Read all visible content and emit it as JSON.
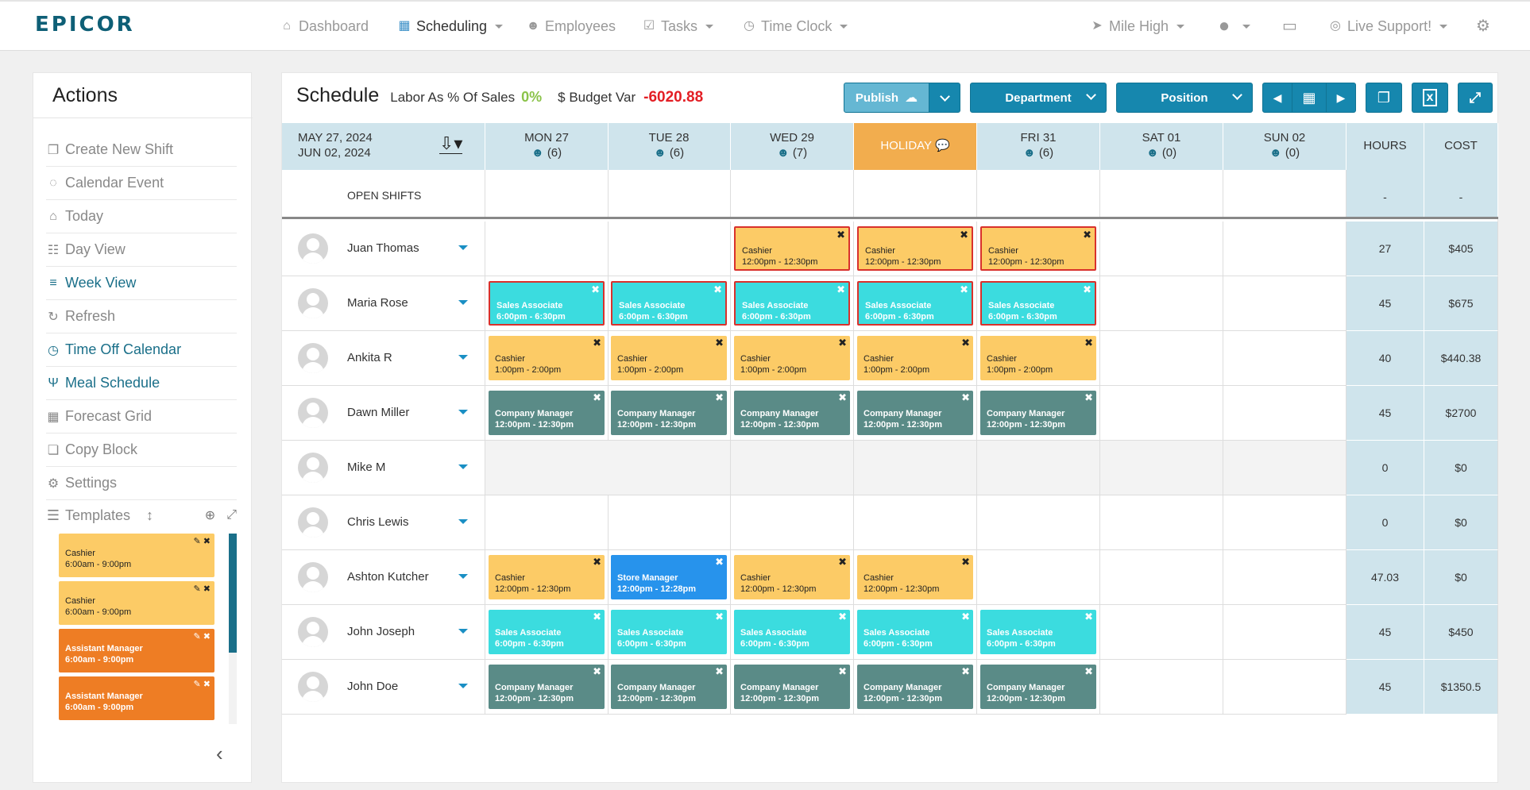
{
  "brand": "EPICOR",
  "nav": {
    "dashboard": "Dashboard",
    "scheduling": "Scheduling",
    "employees": "Employees",
    "tasks": "Tasks",
    "time_clock": "Time Clock",
    "location": "Mile High",
    "support": "Live Support!"
  },
  "sidebar": {
    "title": "Actions",
    "items": [
      {
        "label": "Create New Shift",
        "icon": "copy-icon",
        "style": "grey"
      },
      {
        "label": "Calendar Event",
        "icon": "comment-icon",
        "style": "grey"
      },
      {
        "label": "Today",
        "icon": "home-icon",
        "style": "grey"
      },
      {
        "label": "Day View",
        "icon": "list-icon",
        "style": "grey"
      },
      {
        "label": "Week View",
        "icon": "bars-icon",
        "style": "blue"
      },
      {
        "label": "Refresh",
        "icon": "refresh-icon",
        "style": "grey"
      },
      {
        "label": "Time Off Calendar",
        "icon": "clock-icon",
        "style": "blue"
      },
      {
        "label": "Meal Schedule",
        "icon": "utensils-icon",
        "style": "blue"
      },
      {
        "label": "Forecast Grid",
        "icon": "grid-icon",
        "style": "grey"
      },
      {
        "label": "Copy Block",
        "icon": "clone-icon",
        "style": "grey"
      },
      {
        "label": "Settings",
        "icon": "cogs-icon",
        "style": "grey"
      }
    ],
    "templates_label": "Templates",
    "templates": [
      {
        "role": "Cashier",
        "time": "6:00am - 9:00pm",
        "color": "yellow"
      },
      {
        "role": "Cashier",
        "time": "6:00am - 9:00pm",
        "color": "yellow"
      },
      {
        "role": "Assistant Manager",
        "time": "6:00am - 9:00pm",
        "color": "orange"
      },
      {
        "role": "Assistant Manager",
        "time": "6:00am - 9:00pm",
        "color": "orange"
      },
      {
        "role": "",
        "time": "",
        "color": "teal"
      }
    ]
  },
  "schedule": {
    "title": "Schedule",
    "labor_label": "Labor As % Of Sales",
    "labor_value": "0%",
    "budget_label": "$ Budget Var",
    "budget_value": "-6020.88",
    "publish": "Publish",
    "department": "Department",
    "position": "Position",
    "range_start": "MAY 27, 2024",
    "range_end": "JUN 02, 2024",
    "days": [
      {
        "label": "MON 27",
        "count": "(6)",
        "holiday": false
      },
      {
        "label": "TUE 28",
        "count": "(6)",
        "holiday": false
      },
      {
        "label": "WED 29",
        "count": "(7)",
        "holiday": false
      },
      {
        "label": "HOLIDAY",
        "count": "",
        "holiday": true
      },
      {
        "label": "FRI 31",
        "count": "(6)",
        "holiday": false
      },
      {
        "label": "SAT 01",
        "count": "(0)",
        "holiday": false
      },
      {
        "label": "SUN 02",
        "count": "(0)",
        "holiday": false
      }
    ],
    "hours_header": "HOURS",
    "cost_header": "COST",
    "open_shifts": {
      "label": "OPEN SHIFTS",
      "hours": "-",
      "cost": "-"
    },
    "employees": [
      {
        "name": "Juan Thomas",
        "hours": "27",
        "cost": "$405",
        "grey": false,
        "shifts": [
          {
            "day": 2,
            "role": "Cashier",
            "time": "12:00pm - 12:30pm",
            "color": "yellow",
            "alert": true
          },
          {
            "day": 3,
            "role": "Cashier",
            "time": "12:00pm - 12:30pm",
            "color": "yellow",
            "alert": true
          },
          {
            "day": 4,
            "role": "Cashier",
            "time": "12:00pm - 12:30pm",
            "color": "yellow",
            "alert": true
          }
        ]
      },
      {
        "name": "Maria Rose",
        "hours": "45",
        "cost": "$675",
        "grey": false,
        "shifts": [
          {
            "day": 0,
            "role": "Sales Associate",
            "time": "6:00pm - 6:30pm",
            "color": "teal",
            "alert": true
          },
          {
            "day": 1,
            "role": "Sales Associate",
            "time": "6:00pm - 6:30pm",
            "color": "teal",
            "alert": true
          },
          {
            "day": 2,
            "role": "Sales Associate",
            "time": "6:00pm - 6:30pm",
            "color": "teal",
            "alert": true
          },
          {
            "day": 3,
            "role": "Sales Associate",
            "time": "6:00pm - 6:30pm",
            "color": "teal",
            "alert": true
          },
          {
            "day": 4,
            "role": "Sales Associate",
            "time": "6:00pm - 6:30pm",
            "color": "teal",
            "alert": true
          }
        ]
      },
      {
        "name": "Ankita R",
        "hours": "40",
        "cost": "$440.38",
        "grey": false,
        "shifts": [
          {
            "day": 0,
            "role": "Cashier",
            "time": "1:00pm - 2:00pm",
            "color": "yellow",
            "alert": false
          },
          {
            "day": 1,
            "role": "Cashier",
            "time": "1:00pm - 2:00pm",
            "color": "yellow",
            "alert": false
          },
          {
            "day": 2,
            "role": "Cashier",
            "time": "1:00pm - 2:00pm",
            "color": "yellow",
            "alert": false
          },
          {
            "day": 3,
            "role": "Cashier",
            "time": "1:00pm - 2:00pm",
            "color": "yellow",
            "alert": false
          },
          {
            "day": 4,
            "role": "Cashier",
            "time": "1:00pm - 2:00pm",
            "color": "yellow",
            "alert": false
          }
        ]
      },
      {
        "name": "Dawn Miller",
        "hours": "45",
        "cost": "$2700",
        "grey": false,
        "shifts": [
          {
            "day": 0,
            "role": "Company Manager",
            "time": "12:00pm - 12:30pm",
            "color": "dark",
            "alert": false
          },
          {
            "day": 1,
            "role": "Company Manager",
            "time": "12:00pm - 12:30pm",
            "color": "dark",
            "alert": false
          },
          {
            "day": 2,
            "role": "Company Manager",
            "time": "12:00pm - 12:30pm",
            "color": "dark",
            "alert": false
          },
          {
            "day": 3,
            "role": "Company Manager",
            "time": "12:00pm - 12:30pm",
            "color": "dark",
            "alert": false
          },
          {
            "day": 4,
            "role": "Company Manager",
            "time": "12:00pm - 12:30pm",
            "color": "dark",
            "alert": false
          }
        ]
      },
      {
        "name": "Mike M",
        "hours": "0",
        "cost": "$0",
        "grey": true,
        "shifts": []
      },
      {
        "name": "Chris Lewis",
        "hours": "0",
        "cost": "$0",
        "grey": false,
        "shifts": []
      },
      {
        "name": "Ashton Kutcher",
        "hours": "47.03",
        "cost": "$0",
        "grey": false,
        "shifts": [
          {
            "day": 0,
            "role": "Cashier",
            "time": "12:00pm - 12:30pm",
            "color": "yellow",
            "alert": false
          },
          {
            "day": 1,
            "role": "Store Manager",
            "time": "12:00pm - 12:28pm",
            "color": "blue",
            "alert": false
          },
          {
            "day": 2,
            "role": "Cashier",
            "time": "12:00pm - 12:30pm",
            "color": "yellow",
            "alert": false
          },
          {
            "day": 3,
            "role": "Cashier",
            "time": "12:00pm - 12:30pm",
            "color": "yellow",
            "alert": false
          }
        ]
      },
      {
        "name": "John Joseph",
        "hours": "45",
        "cost": "$450",
        "grey": false,
        "shifts": [
          {
            "day": 0,
            "role": "Sales Associate",
            "time": "6:00pm - 6:30pm",
            "color": "teal",
            "alert": false
          },
          {
            "day": 1,
            "role": "Sales Associate",
            "time": "6:00pm - 6:30pm",
            "color": "teal",
            "alert": false
          },
          {
            "day": 2,
            "role": "Sales Associate",
            "time": "6:00pm - 6:30pm",
            "color": "teal",
            "alert": false
          },
          {
            "day": 3,
            "role": "Sales Associate",
            "time": "6:00pm - 6:30pm",
            "color": "teal",
            "alert": false
          },
          {
            "day": 4,
            "role": "Sales Associate",
            "time": "6:00pm - 6:30pm",
            "color": "teal",
            "alert": false
          }
        ]
      },
      {
        "name": "John Doe",
        "hours": "45",
        "cost": "$1350.5",
        "grey": false,
        "shifts": [
          {
            "day": 0,
            "role": "Company Manager",
            "time": "12:00pm - 12:30pm",
            "color": "dark",
            "alert": false
          },
          {
            "day": 1,
            "role": "Company Manager",
            "time": "12:00pm - 12:30pm",
            "color": "dark",
            "alert": false
          },
          {
            "day": 2,
            "role": "Company Manager",
            "time": "12:00pm - 12:30pm",
            "color": "dark",
            "alert": false
          },
          {
            "day": 3,
            "role": "Company Manager",
            "time": "12:00pm - 12:30pm",
            "color": "dark",
            "alert": false
          },
          {
            "day": 4,
            "role": "Company Manager",
            "time": "12:00pm - 12:30pm",
            "color": "dark",
            "alert": false
          }
        ]
      }
    ]
  },
  "colors": {
    "brand": "#0e5f76",
    "primary_button": "#1687ae",
    "holiday": "#f2ad4e",
    "cashier": "#fccb66",
    "sales_associate": "#3bdcdf",
    "company_manager": "#5a8b87",
    "store_manager": "#2793ec",
    "assistant_manager": "#ee7d24",
    "alert_border": "#d9312c"
  }
}
